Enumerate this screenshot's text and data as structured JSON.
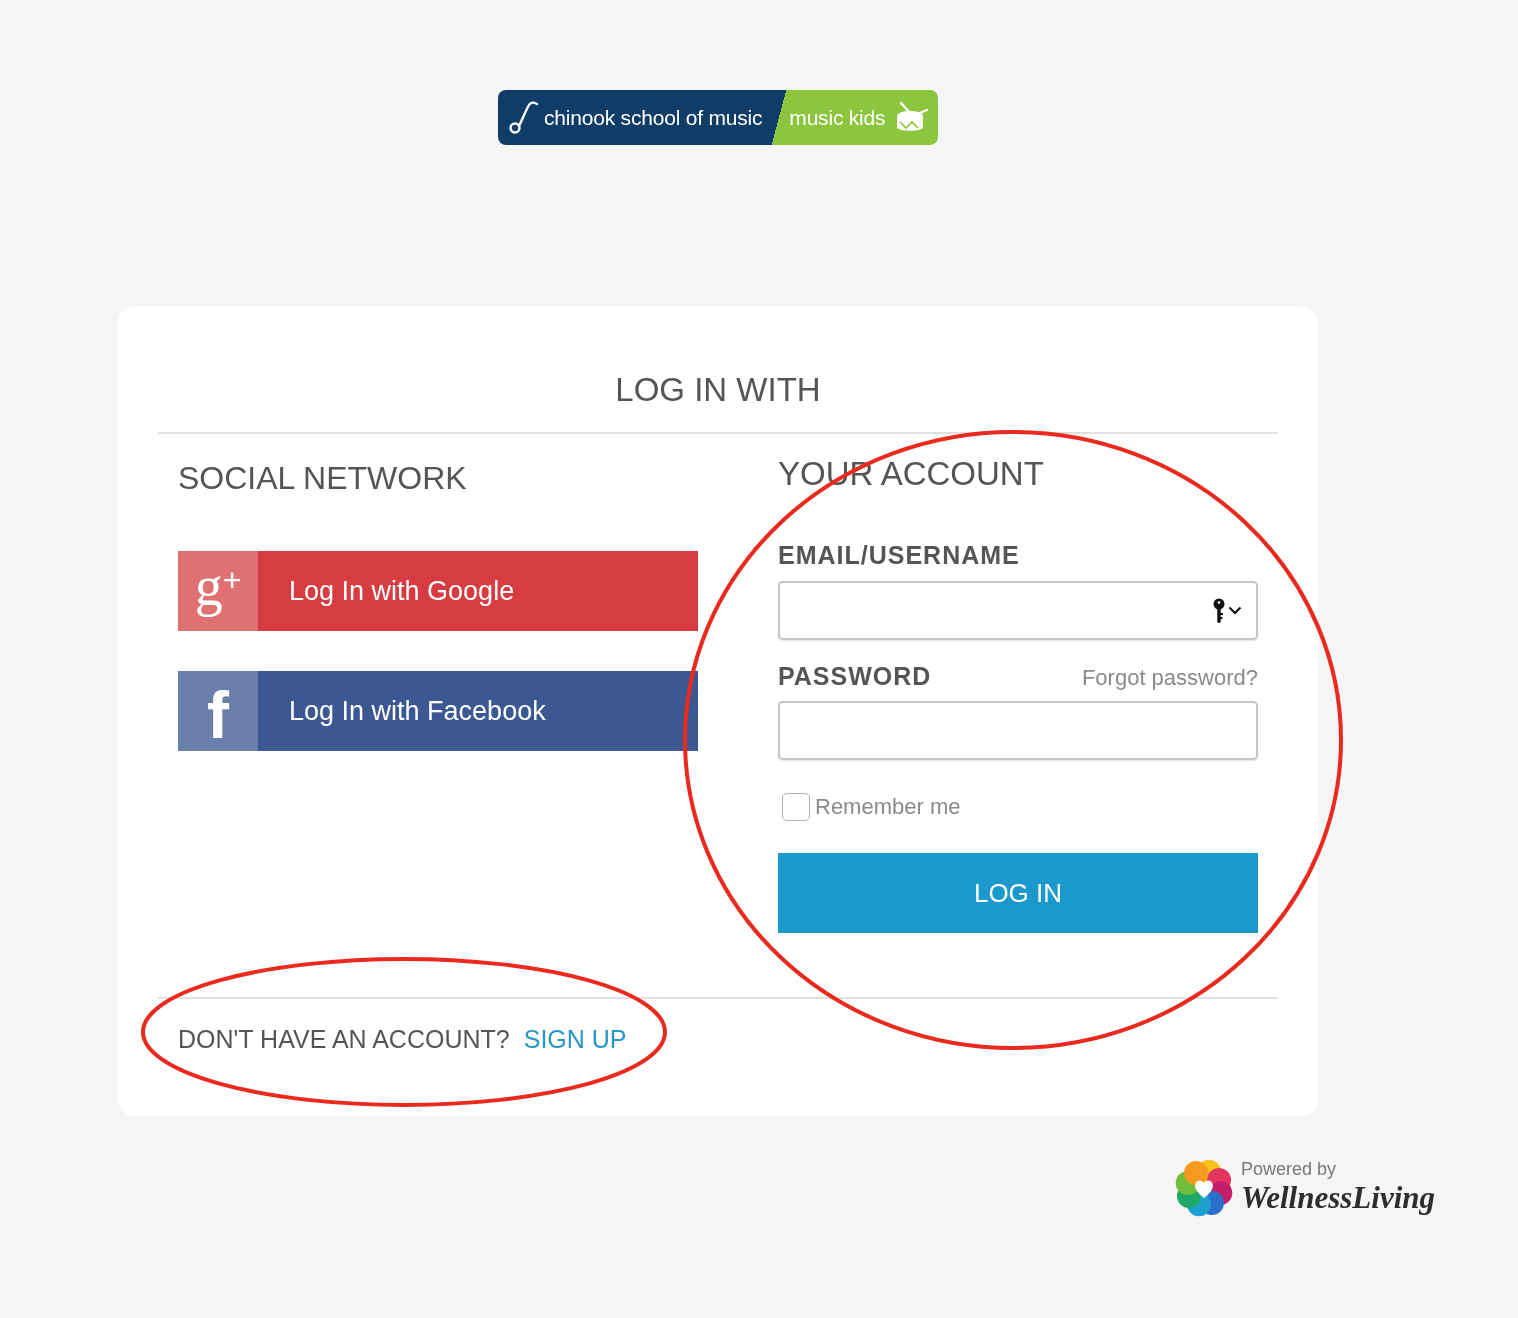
{
  "logo": {
    "school": "chinook school of music",
    "program": "music kids"
  },
  "card": {
    "title": "LOG IN WITH"
  },
  "social": {
    "heading": "SOCIAL NETWORK",
    "buttons": [
      {
        "kind": "google",
        "icon": "g$^{+}$",
        "label": "Log In with Google"
      },
      {
        "kind": "facebook",
        "icon": "f",
        "label": "Log In with Facebook"
      }
    ]
  },
  "account": {
    "heading": "YOUR ACCOUNT",
    "highlighted": true,
    "fields": [
      {
        "label": "EMAIL/USERNAME",
        "key_button": true
      },
      {
        "label": "PASSWORD",
        "link": "Forgot password?",
        "key_button": false
      }
    ],
    "remember": {
      "label": "Remember me",
      "checked": false
    },
    "submit": "LOG IN"
  },
  "signup": {
    "prompt": "DON'T HAVE AN ACCOUNT?",
    "link": "SIGN UP",
    "highlighted": true
  },
  "footer": {
    "powered_by": "Powered by",
    "brand": "WellnessLiving"
  }
}
